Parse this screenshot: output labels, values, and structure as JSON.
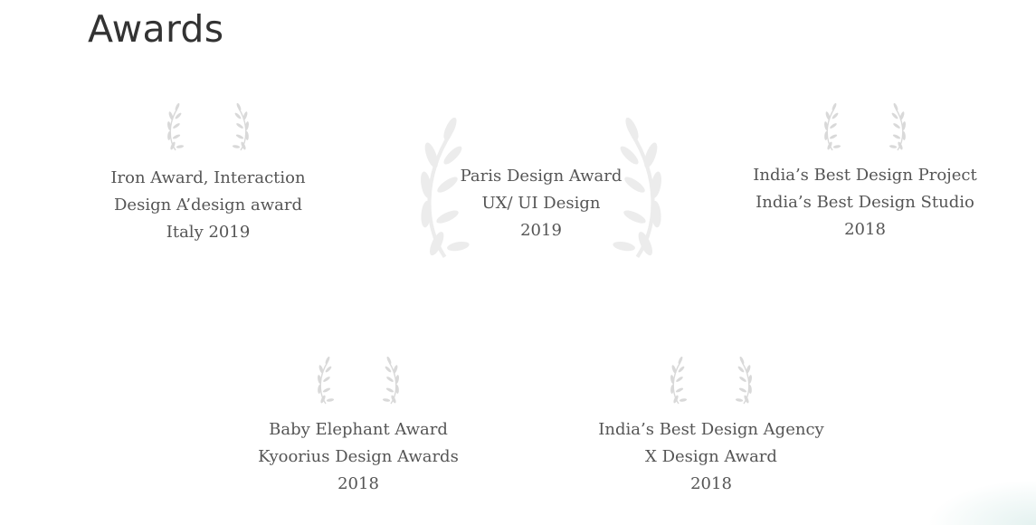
{
  "section": {
    "title": "Awards"
  },
  "awards": [
    {
      "lines": [
        "Iron Award, Interaction",
        "Design A’design award",
        "Italy 2019"
      ],
      "icon": "laurel-wreath-icon"
    },
    {
      "lines": [
        "Paris Design Award",
        "UX/ UI Design",
        "2019"
      ],
      "icon": "laurel-wreath-icon"
    },
    {
      "lines": [
        "India’s Best Design Project",
        "India’s Best Design Studio",
        "2018"
      ],
      "icon": "laurel-wreath-icon"
    },
    {
      "lines": [
        "Baby Elephant Award",
        "Kyoorius Design Awards",
        "2018"
      ],
      "icon": "laurel-wreath-icon"
    },
    {
      "lines": [
        "India’s Best Design Agency",
        "X Design Award",
        "2018"
      ],
      "icon": "laurel-wreath-icon"
    }
  ],
  "colors": {
    "text": "#555555",
    "title": "#333333",
    "laurel": "#d9d9d9",
    "laurel_featured": "#ececec"
  }
}
